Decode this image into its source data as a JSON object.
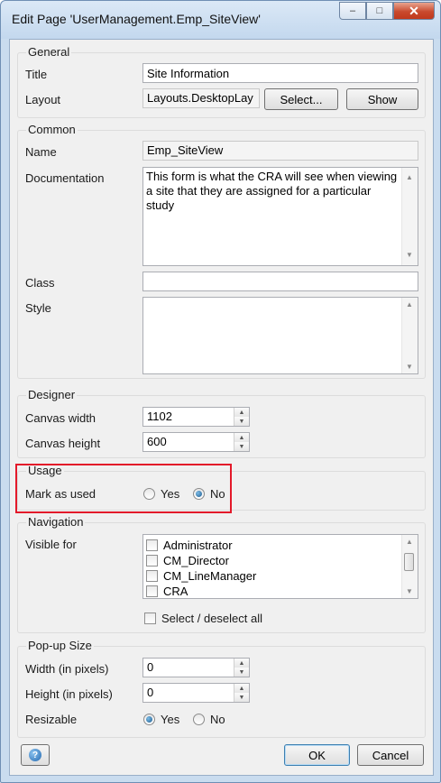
{
  "window": {
    "title": "Edit Page 'UserManagement.Emp_SiteView'"
  },
  "general": {
    "heading": "General",
    "title_label": "Title",
    "title_value": "Site Information",
    "layout_label": "Layout",
    "layout_value": "Layouts.DesktopLay",
    "select_button": "Select...",
    "show_button": "Show"
  },
  "common": {
    "heading": "Common",
    "name_label": "Name",
    "name_value": "Emp_SiteView",
    "documentation_label": "Documentation",
    "documentation_value": "This form is what the CRA will see when viewing a site that they are assigned for a particular study",
    "class_label": "Class",
    "class_value": "",
    "style_label": "Style",
    "style_value": ""
  },
  "designer": {
    "heading": "Designer",
    "canvas_width_label": "Canvas width",
    "canvas_width_value": "1102",
    "canvas_height_label": "Canvas height",
    "canvas_height_value": "600"
  },
  "usage": {
    "heading": "Usage",
    "mark_label": "Mark as used",
    "yes_label": "Yes",
    "no_label": "No",
    "selected": "No"
  },
  "navigation": {
    "heading": "Navigation",
    "visible_label": "Visible for",
    "roles": [
      "Administrator",
      "CM_Director",
      "CM_LineManager",
      "CRA"
    ],
    "select_all_label": "Select / deselect all"
  },
  "popup": {
    "heading": "Pop-up Size",
    "width_label": "Width (in pixels)",
    "width_value": "0",
    "height_label": "Height (in pixels)",
    "height_value": "0",
    "resizable_label": "Resizable",
    "yes_label": "Yes",
    "no_label": "No",
    "selected": "Yes"
  },
  "footer": {
    "ok": "OK",
    "cancel": "Cancel"
  },
  "colors": {
    "highlight": "#e3192a",
    "accent": "#3c7fb1"
  }
}
